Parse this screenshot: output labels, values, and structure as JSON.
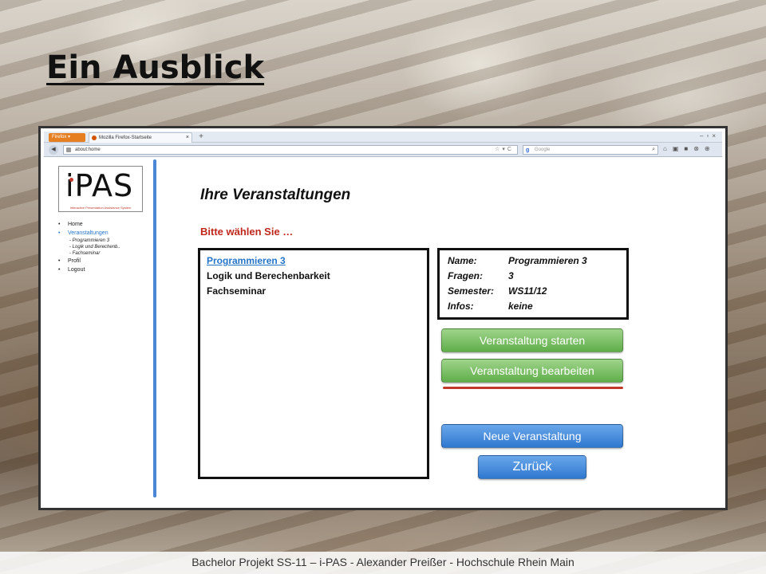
{
  "slide": {
    "title": "Ein Ausblick",
    "footer": "Bachelor Projekt SS-11 – i-PAS - Alexander Preißer - Hochschule Rhein Main"
  },
  "browser": {
    "app_button": "Firefox ▾",
    "tab_title": "Mozilla Firefox-Startseite",
    "url": "about:home",
    "search_placeholder": "Google"
  },
  "logo": {
    "text": "iPAS",
    "subtitle": "Interactive Presentation Assistance System"
  },
  "sidebar": {
    "items": [
      {
        "label": "Home"
      },
      {
        "label": "Veranstaltungen"
      },
      {
        "label": "- Programmieren 3"
      },
      {
        "label": "- Logik und Berechenb.."
      },
      {
        "label": "- Fachseminar"
      },
      {
        "label": "Profil"
      },
      {
        "label": "Logout"
      }
    ]
  },
  "main": {
    "heading": "Ihre Veranstaltungen",
    "prompt": "Bitte wählen Sie …",
    "courses": [
      "Programmieren 3",
      "Logik und Berechenbarkeit",
      "Fachseminar"
    ],
    "details": {
      "name_label": "Name:",
      "name_value": "Programmieren 3",
      "questions_label": "Fragen:",
      "questions_value": "3",
      "semester_label": "Semester:",
      "semester_value": "WS11/12",
      "infos_label": "Infos:",
      "infos_value": "keine"
    },
    "buttons": {
      "start": "Veranstaltung  starten",
      "edit": "Veranstaltung  bearbeiten",
      "new": "Neue Veranstaltung",
      "back": "Zurück"
    }
  },
  "colors": {
    "accent_blue": "#2574c8",
    "prompt_red": "#c0281e",
    "button_green": "#5fae4a",
    "button_blue": "#2f78d0"
  }
}
